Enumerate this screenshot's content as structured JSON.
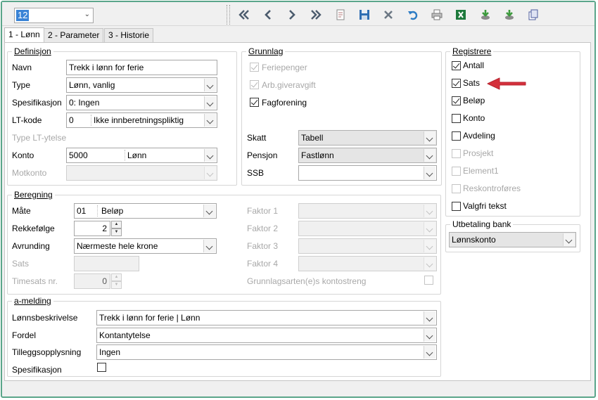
{
  "toolbar": {
    "record_value": "12",
    "icons": [
      "first-icon",
      "previous-icon",
      "next-icon",
      "last-icon",
      "new-icon",
      "save-icon",
      "delete-icon",
      "undo-icon",
      "print-icon",
      "excel-icon",
      "export-icon",
      "import-icon",
      "copy-icon"
    ]
  },
  "tabs": [
    {
      "label": "1 - Lønn",
      "active": true
    },
    {
      "label": "2 - Parameter",
      "active": false
    },
    {
      "label": "3 - Historie",
      "active": false
    }
  ],
  "definisjon": {
    "title": "Definisjon",
    "navn_label": "Navn",
    "navn_value": "Trekk i lønn for ferie",
    "type_label": "Type",
    "type_value": "Lønn, vanlig",
    "spesifikasjon_label": "Spesifikasjon",
    "spesifikasjon_value": "0:  Ingen",
    "ltkode_label": "LT-kode",
    "ltkode_code": "0",
    "ltkode_text": "Ikke innberetningspliktig",
    "type_lt_label": "Type LT-ytelse",
    "konto_label": "Konto",
    "konto_code": "5000",
    "konto_text": "Lønn",
    "motkonto_label": "Motkonto"
  },
  "grunnlag": {
    "title": "Grunnlag",
    "feriepenger": "Feriepenger",
    "arbgiveravgift": "Arb.giveravgift",
    "fagforening": "Fagforening",
    "skatt_label": "Skatt",
    "skatt_value": "Tabell",
    "pensjon_label": "Pensjon",
    "pensjon_value": "Fastlønn",
    "ssb_label": "SSB"
  },
  "registrere": {
    "title": "Registrere",
    "items": [
      {
        "label": "Antall",
        "checked": true,
        "enabled": true
      },
      {
        "label": "Sats",
        "checked": true,
        "enabled": true
      },
      {
        "label": "Beløp",
        "checked": true,
        "enabled": true
      },
      {
        "label": "Konto",
        "checked": false,
        "enabled": true
      },
      {
        "label": "Avdeling",
        "checked": false,
        "enabled": true
      },
      {
        "label": "Prosjekt",
        "checked": false,
        "enabled": false
      },
      {
        "label": "Element1",
        "checked": false,
        "enabled": false
      },
      {
        "label": "Reskontroføres",
        "checked": false,
        "enabled": false
      },
      {
        "label": "Valgfri tekst",
        "checked": false,
        "enabled": true
      }
    ]
  },
  "utbetaling": {
    "title": "Utbetaling bank",
    "value": "Lønnskonto"
  },
  "beregning": {
    "title": "Beregning",
    "maate_label": "Måte",
    "maate_code": "01",
    "maate_text": "Beløp",
    "rekkefolge_label": "Rekkefølge",
    "rekkefolge_value": "2",
    "avrunding_label": "Avrunding",
    "avrunding_value": "Nærmeste hele krone",
    "sats_label": "Sats",
    "timesats_label": "Timesats nr.",
    "timesats_value": "0",
    "faktor1_label": "Faktor 1",
    "faktor2_label": "Faktor 2",
    "faktor3_label": "Faktor 3",
    "faktor4_label": "Faktor 4",
    "kontostreng_label": "Grunnlagsarten(e)s kontostreng"
  },
  "amelding": {
    "title": "a-melding",
    "lonnsbeskrivelse_label": "Lønnsbeskrivelse",
    "lonnsbeskrivelse_value": "Trekk i lønn for ferie | Lønn",
    "fordel_label": "Fordel",
    "fordel_value": "Kontantytelse",
    "tillegg_label": "Tilleggsopplysning",
    "tillegg_value": "Ingen",
    "spesifikasjon_label": "Spesifikasjon"
  },
  "colors": {
    "frame": "#5aa58a",
    "arrow": "#d4303b",
    "selection": "#3a83d6"
  }
}
